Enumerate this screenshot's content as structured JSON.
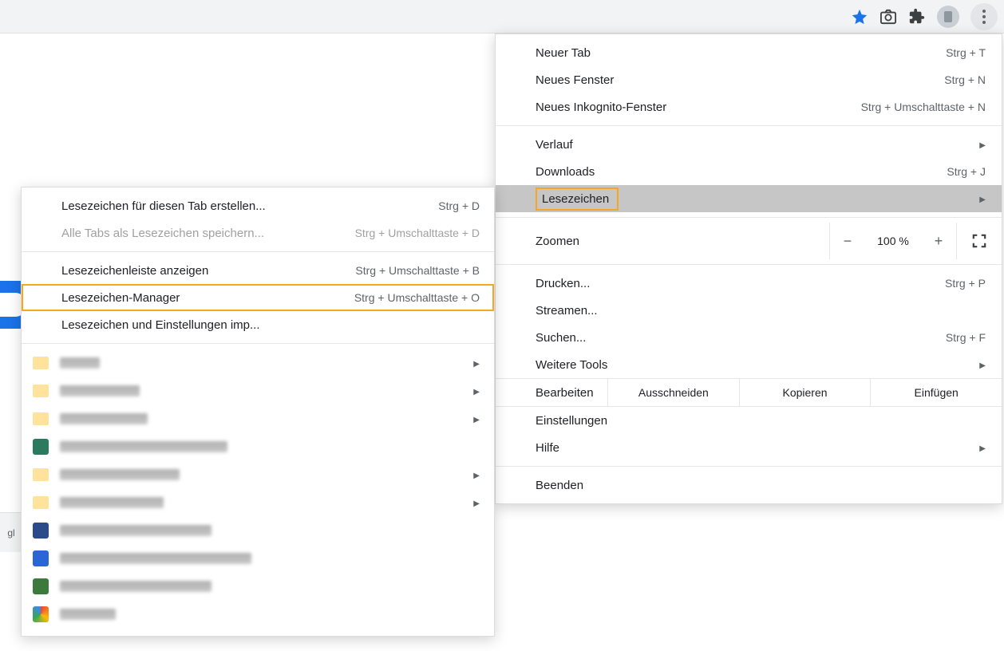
{
  "toolbar": {
    "star_icon": "star-icon",
    "camera_icon": "camera-icon",
    "extensions_icon": "extensions-icon",
    "profile_icon": "profile-avatar",
    "menu_icon": "more-menu-icon"
  },
  "main_menu": {
    "new_tab": "Neuer Tab",
    "new_tab_sc": "Strg + T",
    "new_window": "Neues Fenster",
    "new_window_sc": "Strg + N",
    "new_incognito": "Neues Inkognito-Fenster",
    "new_incognito_sc": "Strg + Umschalttaste + N",
    "history": "Verlauf",
    "downloads": "Downloads",
    "downloads_sc": "Strg + J",
    "bookmarks": "Lesezeichen",
    "zoom_label": "Zoomen",
    "zoom_minus": "−",
    "zoom_pct": "100 %",
    "zoom_plus": "+",
    "print": "Drucken...",
    "print_sc": "Strg + P",
    "cast": "Streamen...",
    "find": "Suchen...",
    "find_sc": "Strg + F",
    "more_tools": "Weitere Tools",
    "edit_label": "Bearbeiten",
    "cut": "Ausschneiden",
    "copy": "Kopieren",
    "paste": "Einfügen",
    "settings": "Einstellungen",
    "help": "Hilfe",
    "exit": "Beenden"
  },
  "sub_menu": {
    "bookmark_tab": "Lesezeichen für diesen Tab erstellen...",
    "bookmark_tab_sc": "Strg + D",
    "bookmark_all": "Alle Tabs als Lesezeichen speichern...",
    "bookmark_all_sc": "Strg + Umschalttaste + D",
    "show_bar": "Lesezeichenleiste anzeigen",
    "show_bar_sc": "Strg + Umschalttaste + B",
    "manager": "Lesezeichen-Manager",
    "manager_sc": "Strg + Umschalttaste + O",
    "import": "Lesezeichen und Einstellungen imp..."
  }
}
